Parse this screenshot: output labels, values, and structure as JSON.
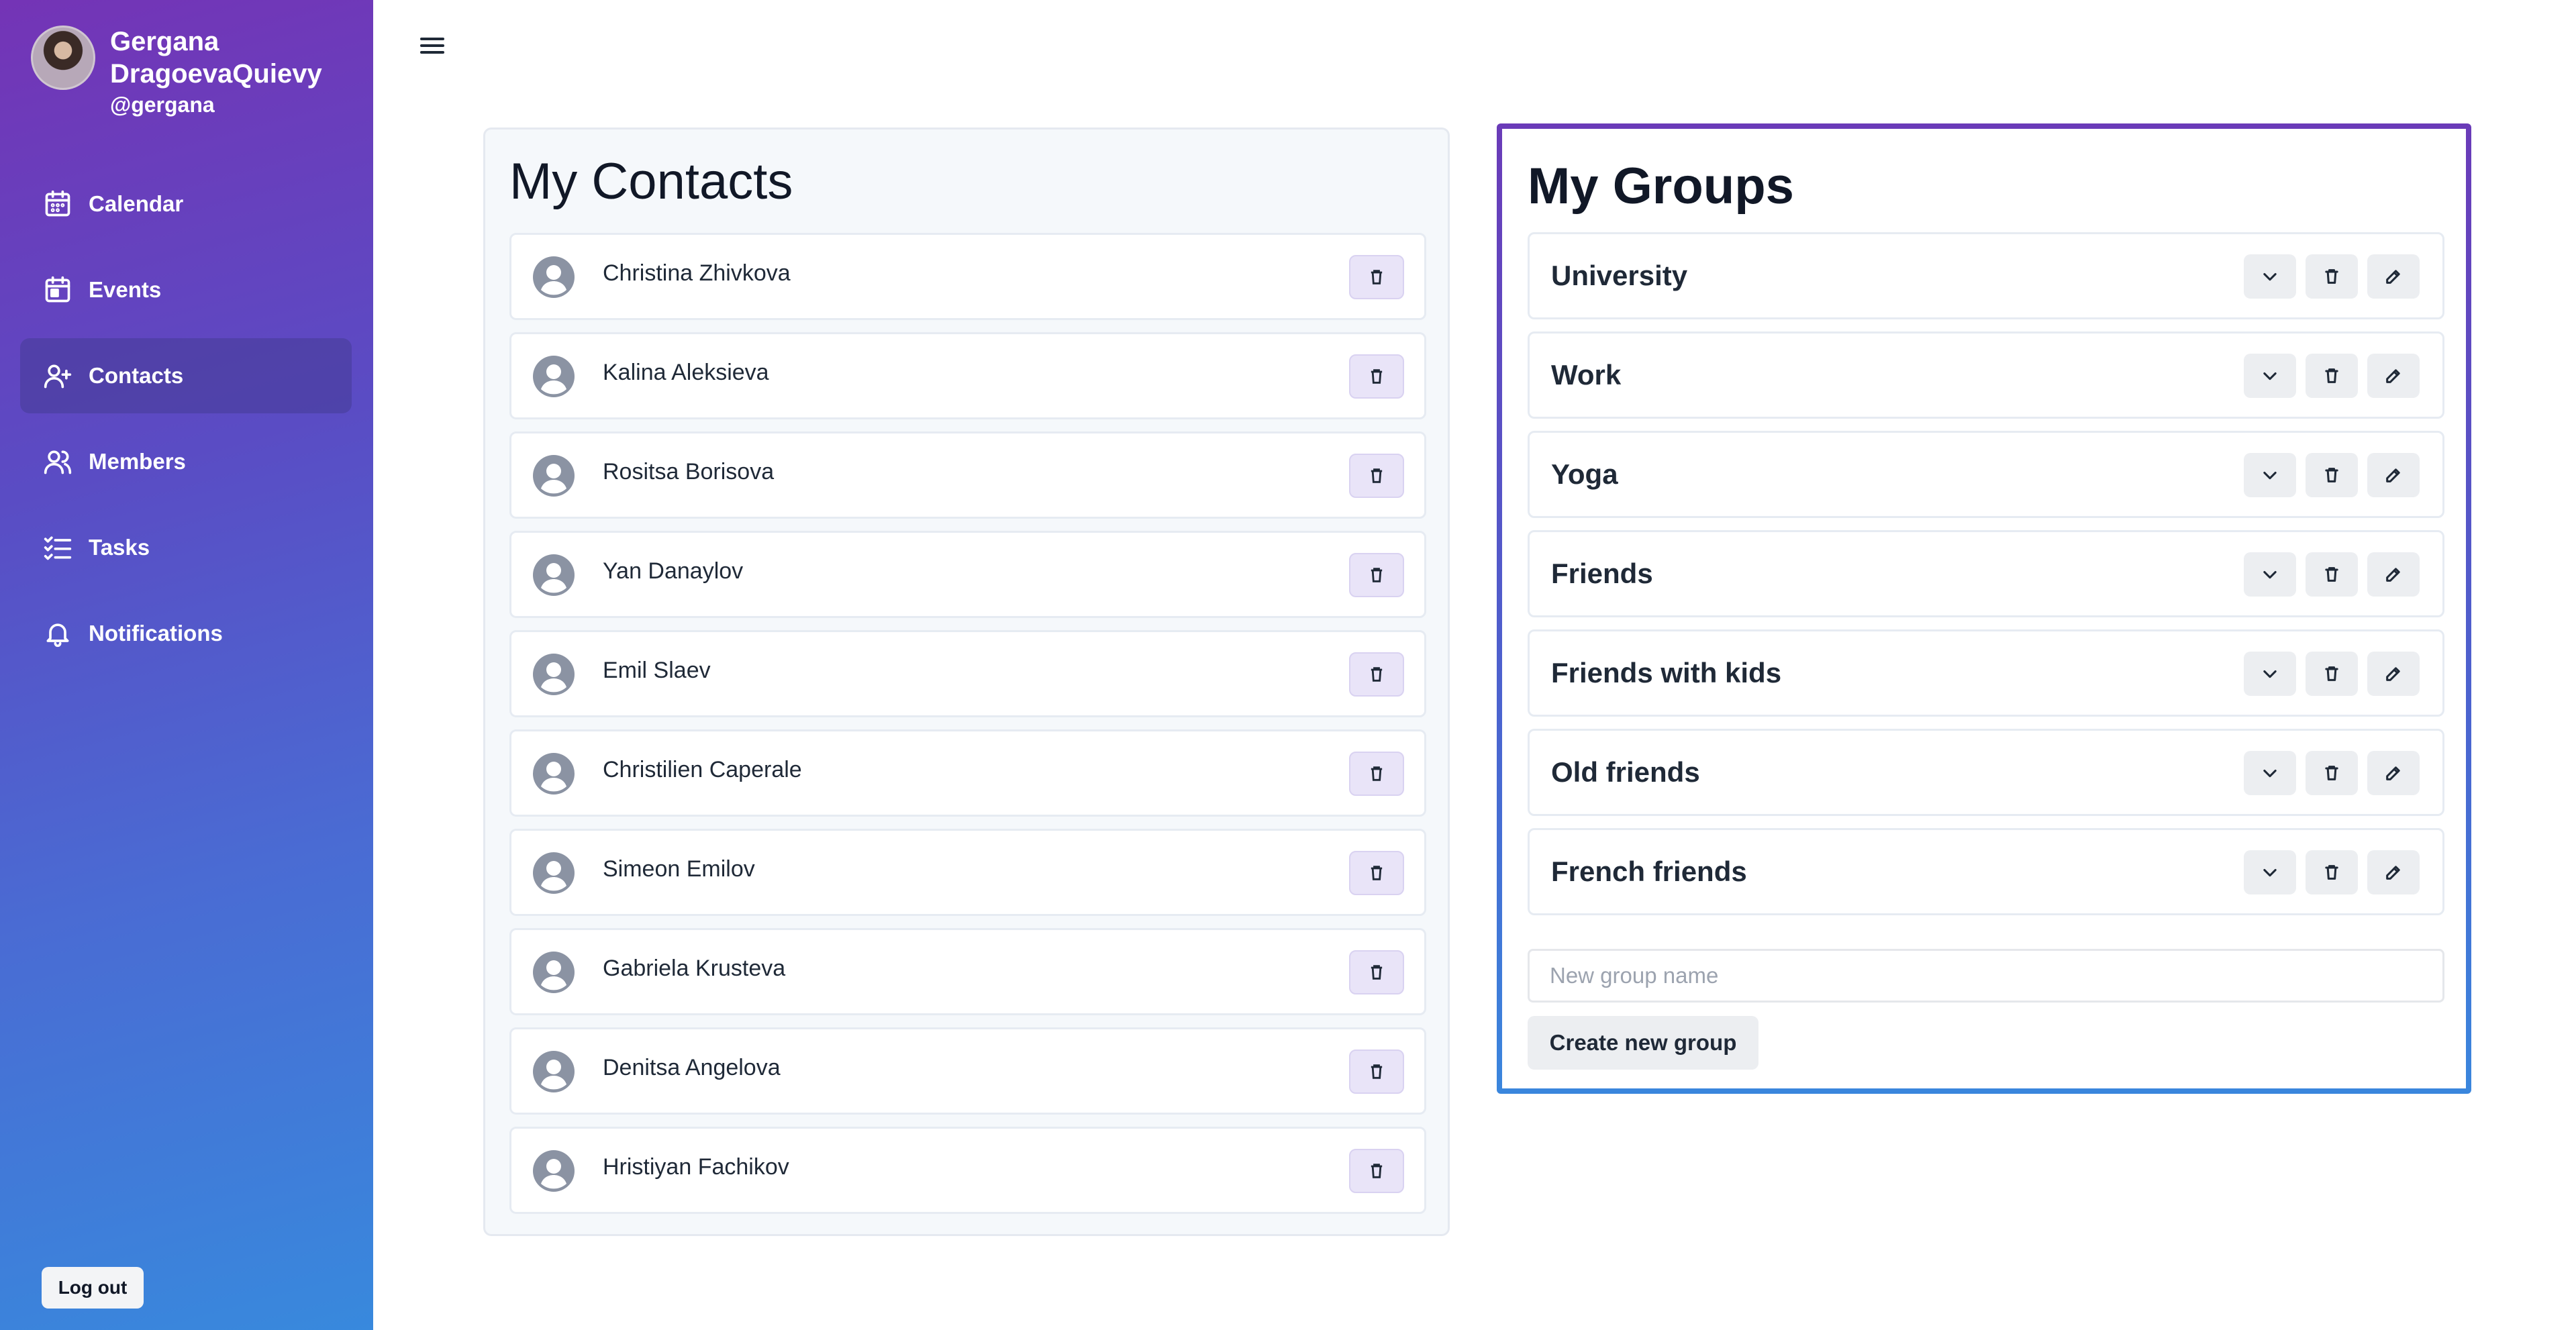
{
  "user": {
    "name": "Gergana DragoevaQuievy",
    "handle": "@gergana"
  },
  "sidebar": {
    "items": [
      {
        "label": "Calendar",
        "icon": "calendar-icon"
      },
      {
        "label": "Events",
        "icon": "event-icon"
      },
      {
        "label": "Contacts",
        "icon": "user-plus-icon",
        "active": true
      },
      {
        "label": "Members",
        "icon": "users-icon"
      },
      {
        "label": "Tasks",
        "icon": "task-list-icon"
      },
      {
        "label": "Notifications",
        "icon": "bell-icon"
      }
    ],
    "logout_label": "Log out"
  },
  "contacts": {
    "title": "My Contacts",
    "items": [
      {
        "name": "Christina Zhivkova"
      },
      {
        "name": "Kalina Aleksieva"
      },
      {
        "name": "Rositsa Borisova"
      },
      {
        "name": "Yan Danaylov"
      },
      {
        "name": "Emil Slaev"
      },
      {
        "name": "Christilien Caperale"
      },
      {
        "name": "Simeon Emilov"
      },
      {
        "name": "Gabriela Krusteva"
      },
      {
        "name": "Denitsa Angelova"
      },
      {
        "name": "Hristiyan Fachikov"
      }
    ]
  },
  "groups": {
    "title": "My Groups",
    "items": [
      {
        "name": "University"
      },
      {
        "name": "Work"
      },
      {
        "name": "Yoga"
      },
      {
        "name": "Friends"
      },
      {
        "name": "Friends with kids"
      },
      {
        "name": "Old friends"
      },
      {
        "name": "French friends"
      }
    ],
    "new_group_placeholder": "New group name",
    "new_group_value": "",
    "create_label": "Create new group"
  },
  "colors": {
    "sidebar_gradient_start": "#7434b6",
    "sidebar_gradient_end": "#3889dd",
    "trash_button_bg": "#e9e4f8",
    "groups_border": "#5b4fc7"
  }
}
